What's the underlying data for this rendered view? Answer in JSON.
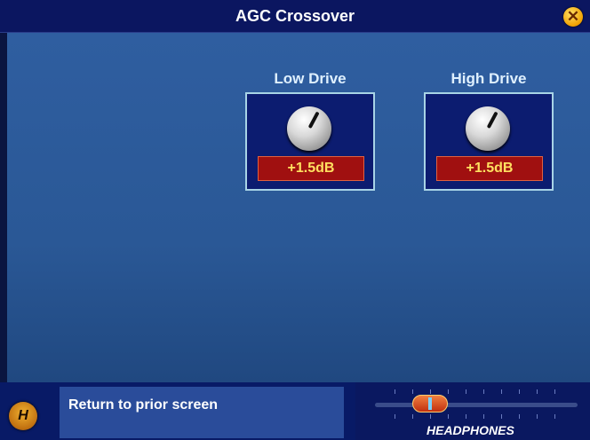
{
  "window": {
    "title": "AGC Crossover",
    "close_icon": "close-icon"
  },
  "panels": [
    {
      "label": "Low Drive",
      "value": "+1.5dB"
    },
    {
      "label": "High Drive",
      "value": "+1.5dB"
    }
  ],
  "footer": {
    "help_button": "H",
    "hint": "Return to prior screen",
    "fader_label": "HEADPHONES"
  },
  "colors": {
    "accent": "#f0a000",
    "readout_bg": "#a01010",
    "readout_text": "#ffe060"
  }
}
